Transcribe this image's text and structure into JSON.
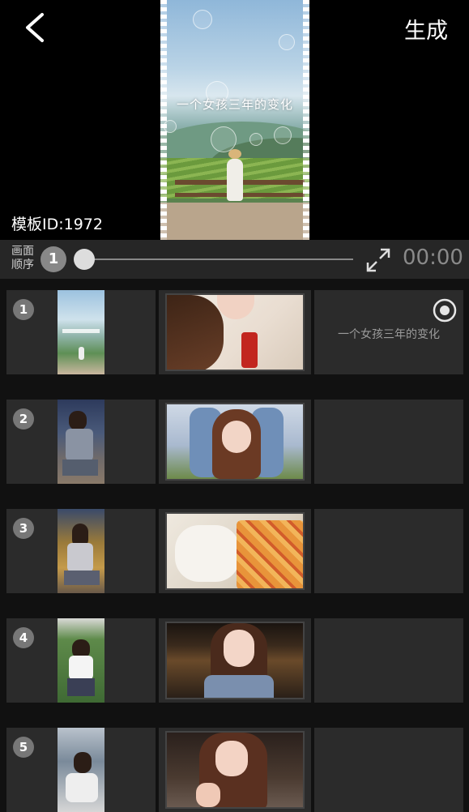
{
  "header": {
    "generate_label": "生成",
    "template_id": "模板ID:1972",
    "preview_title": "一个女孩三年的变化"
  },
  "controls": {
    "order_label": "画面顺序",
    "order_value": "1",
    "time": "00:00",
    "progress": 0
  },
  "rows": [
    {
      "number": "1",
      "text": "一个女孩三年的变化"
    },
    {
      "number": "2",
      "text": ""
    },
    {
      "number": "3",
      "text": ""
    },
    {
      "number": "4",
      "text": ""
    },
    {
      "number": "5",
      "text": ""
    }
  ],
  "icons": [
    "back-arrow-icon",
    "expand-icon",
    "eye-icon"
  ]
}
